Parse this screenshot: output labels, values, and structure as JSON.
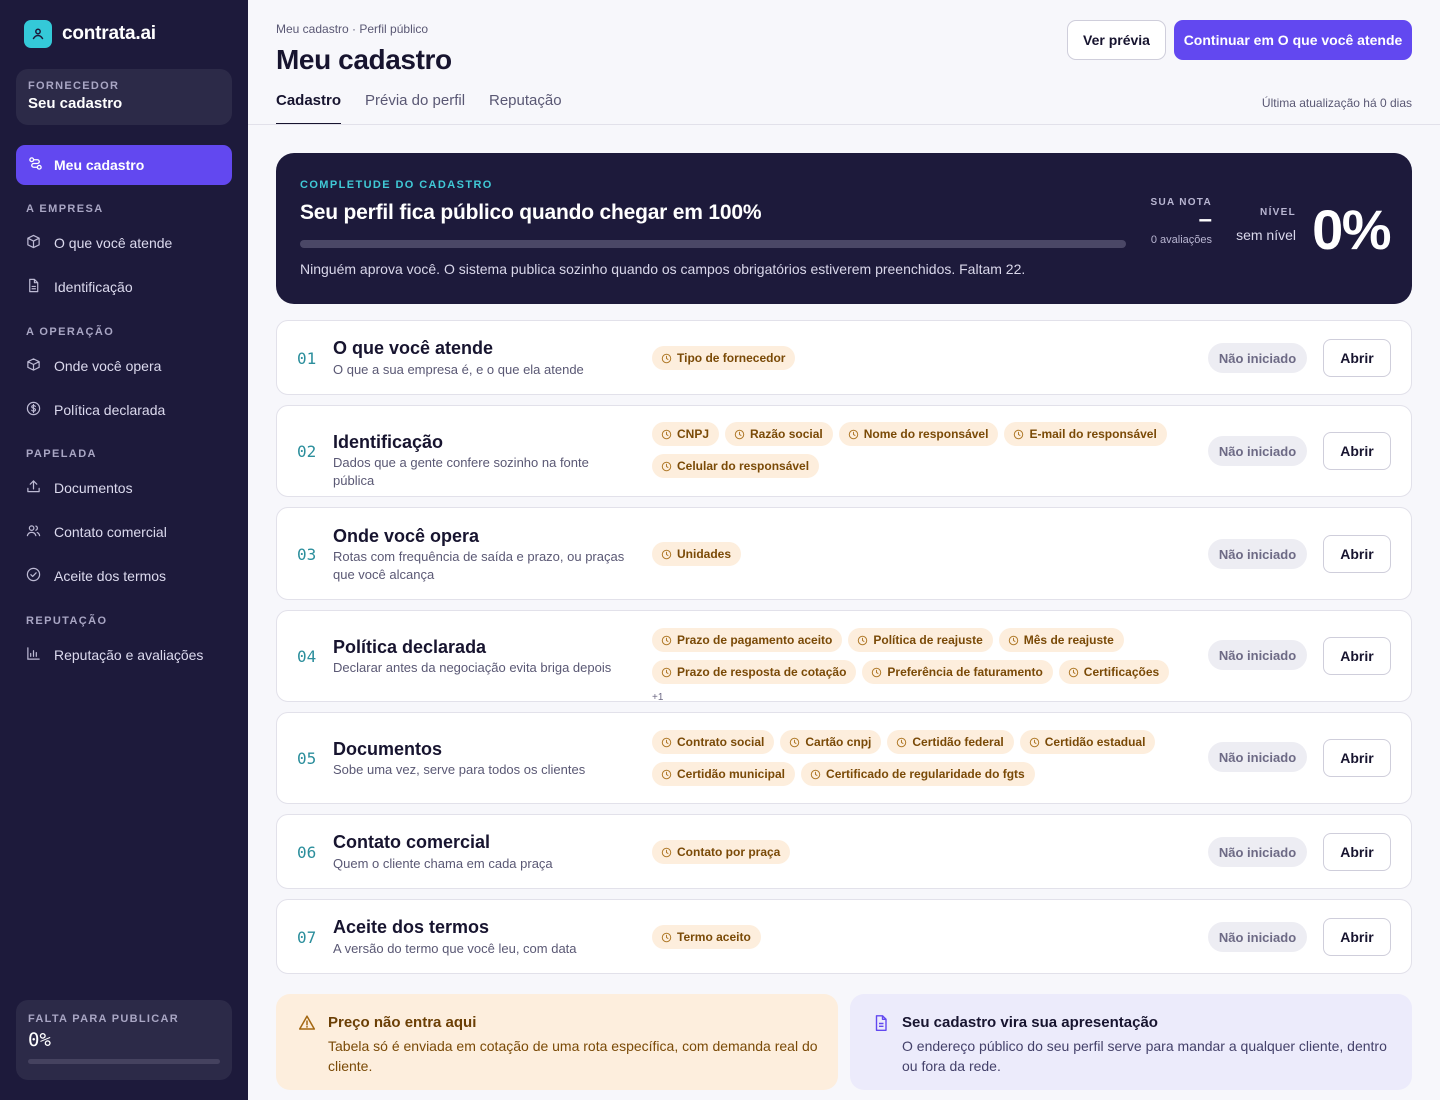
{
  "brand": {
    "name": "contrata.ai"
  },
  "sidebar": {
    "role_caption": "FORNECEDOR",
    "role_title": "Seu cadastro",
    "active_item": "Meu cadastro",
    "sections": [
      {
        "title": "A EMPRESA",
        "items": [
          "O que você atende",
          "Identificação"
        ]
      },
      {
        "title": "A OPERAÇÃO",
        "items": [
          "Onde você opera",
          "Política declarada"
        ]
      },
      {
        "title": "PAPELADA",
        "items": [
          "Documentos",
          "Contato comercial",
          "Aceite dos termos"
        ]
      },
      {
        "title": "REPUTAÇÃO",
        "items": [
          "Reputação e avaliações"
        ]
      }
    ],
    "publish": {
      "caption": "FALTA PARA PUBLICAR",
      "value": "0%",
      "progress_fraction": 0
    }
  },
  "header": {
    "breadcrumb": "Meu cadastro · Perfil público",
    "title": "Meu cadastro",
    "preview_button": "Ver prévia",
    "continue_button": "Continuar em O que você atende",
    "tabs": [
      "Cadastro",
      "Prévia do perfil",
      "Reputação"
    ],
    "updated": "Última atualização há 0 dias"
  },
  "hero": {
    "caption": "COMPLETUDE DO CADASTRO",
    "title": "Seu perfil fica público quando chegar em 100%",
    "note": "Ninguém aprova você. O sistema publica sozinho quando os campos obrigatórios estiverem preenchidos. Faltam 22.",
    "progress_fraction": 0,
    "score_caption": "SUA NOTA",
    "score_value": "–",
    "score_sub": "0 avaliações",
    "level_caption": "NÍVEL",
    "level_value": "sem nível",
    "percent": "0%"
  },
  "sections": [
    {
      "num": "01",
      "title": "O que você atende",
      "desc": "O que a sua empresa é, e o que ela atende",
      "tags": [
        "Tipo de fornecedor"
      ],
      "more": "",
      "status": "Não iniciado",
      "action": "Abrir"
    },
    {
      "num": "02",
      "title": "Identificação",
      "desc": "Dados que a gente confere sozinho na fonte pública",
      "tags": [
        "CNPJ",
        "Razão social",
        "Nome do responsável",
        "E-mail do responsável",
        "Celular do responsável"
      ],
      "more": "",
      "status": "Não iniciado",
      "action": "Abrir"
    },
    {
      "num": "03",
      "title": "Onde você opera",
      "desc": "Rotas com frequência de saída e prazo, ou praças que você alcança",
      "tags": [
        "Unidades"
      ],
      "more": "",
      "status": "Não iniciado",
      "action": "Abrir"
    },
    {
      "num": "04",
      "title": "Política declarada",
      "desc": "Declarar antes da negociação evita briga depois",
      "tags": [
        "Prazo de pagamento aceito",
        "Política de reajuste",
        "Mês de reajuste",
        "Prazo de resposta de cotação",
        "Preferência de faturamento",
        "Certificações"
      ],
      "more": "+1",
      "status": "Não iniciado",
      "action": "Abrir"
    },
    {
      "num": "05",
      "title": "Documentos",
      "desc": "Sobe uma vez, serve para todos os clientes",
      "tags": [
        "Contrato social",
        "Cartão cnpj",
        "Certidão federal",
        "Certidão estadual",
        "Certidão municipal",
        "Certificado de regularidade do fgts"
      ],
      "more": "",
      "status": "Não iniciado",
      "action": "Abrir"
    },
    {
      "num": "06",
      "title": "Contato comercial",
      "desc": "Quem o cliente chama em cada praça",
      "tags": [
        "Contato por praça"
      ],
      "more": "",
      "status": "Não iniciado",
      "action": "Abrir"
    },
    {
      "num": "07",
      "title": "Aceite dos termos",
      "desc": "A versão do termo que você leu, com data",
      "tags": [
        "Termo aceito"
      ],
      "more": "",
      "status": "Não iniciado",
      "action": "Abrir"
    }
  ],
  "info": {
    "price": {
      "title": "Preço não entra aqui",
      "text": "Tabela só é enviada em cotação de uma rota específica, com demanda real do cliente."
    },
    "presentation": {
      "title": "Seu cadastro vira sua apresentação",
      "text": "O endereço público do seu perfil serve para mandar a qualquer cliente, dentro ou fora da rede."
    }
  },
  "colors": {
    "accent": "#6248f0",
    "sidebar_bg": "#1d1a3b",
    "teal": "#34c9d8",
    "tag_bg": "#fdeedd",
    "tag_text": "#7a4a07"
  }
}
